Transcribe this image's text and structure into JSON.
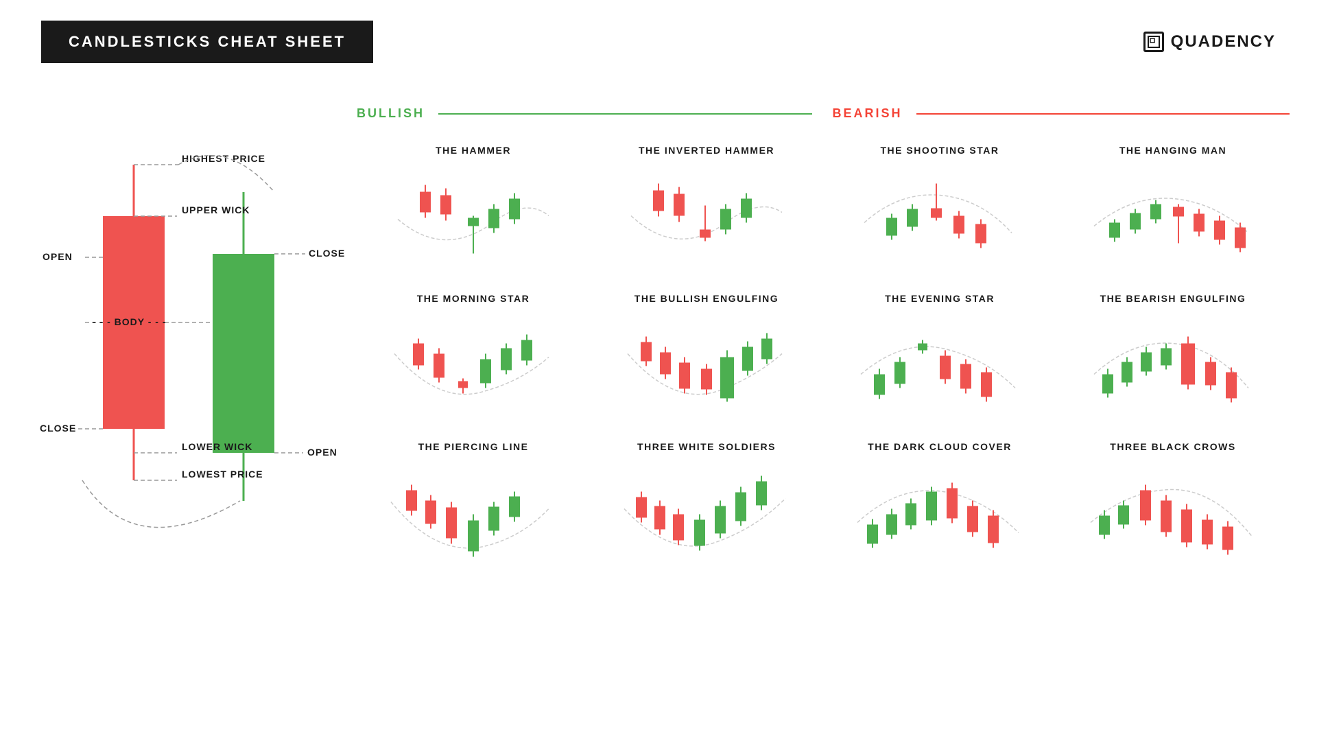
{
  "header": {
    "title": "CANDLESTICKS CHEAT SHEET",
    "logo_text": "QUADENCY"
  },
  "anatomy": {
    "labels": {
      "highest_price": "HIGHEST PRICE",
      "upper_wick": "UPPER WICK",
      "open_left": "OPEN",
      "close_right": "CLOSE",
      "body": "BODY",
      "close_left": "CLOSE",
      "lower_wick": "LOWER WICK",
      "lowest_price": "LOWEST PRICE",
      "open_right": "OPEN"
    }
  },
  "categories": {
    "bullish": "BULLISH",
    "bearish": "BEARISH"
  },
  "patterns": [
    [
      {
        "id": "hammer",
        "title": "THE HAMMER",
        "type": "bullish"
      },
      {
        "id": "inverted_hammer",
        "title": "THE INVERTED HAMMER",
        "type": "bullish"
      },
      {
        "id": "shooting_star",
        "title": "THE SHOOTING STAR",
        "type": "bearish"
      },
      {
        "id": "hanging_man",
        "title": "THE HANGING MAN",
        "type": "bearish"
      }
    ],
    [
      {
        "id": "morning_star",
        "title": "THE MORNING STAR",
        "type": "bullish"
      },
      {
        "id": "bullish_engulfing",
        "title": "THE BULLISH ENGULFING",
        "type": "bullish"
      },
      {
        "id": "evening_star",
        "title": "THE EVENING STAR",
        "type": "bearish"
      },
      {
        "id": "bearish_engulfing",
        "title": "THE BEARISH ENGULFING",
        "type": "bearish"
      }
    ],
    [
      {
        "id": "piercing_line",
        "title": "THE PIERCING LINE",
        "type": "bullish"
      },
      {
        "id": "three_white_soldiers",
        "title": "THREE WHITE SOLDIERS",
        "type": "bullish"
      },
      {
        "id": "dark_cloud_cover",
        "title": "THE DARK CLOUD COVER",
        "type": "bearish"
      },
      {
        "id": "three_black_crows",
        "title": "THREE BLACK CROWS",
        "type": "bearish"
      }
    ]
  ],
  "colors": {
    "bullish": "#ef5350",
    "bearish_red": "#ef5350",
    "green": "#4caf50",
    "red": "#ef5350"
  }
}
